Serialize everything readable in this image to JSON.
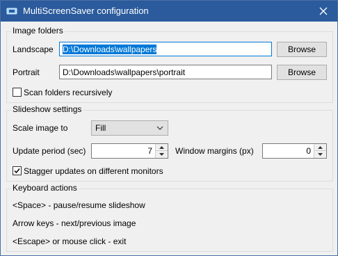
{
  "window": {
    "title": "MultiScreenSaver configuration"
  },
  "image_folders": {
    "title": "Image folders",
    "landscape": {
      "label": "Landscape",
      "value": "D:\\Downloads\\wallpapers",
      "browse": "Browse"
    },
    "portrait": {
      "label": "Portrait",
      "value": "D:\\Downloads\\wallpapers\\portrait",
      "browse": "Browse"
    },
    "recursive": {
      "label": "Scan folders recursively",
      "checked": false
    }
  },
  "slideshow": {
    "title": "Slideshow settings",
    "scale": {
      "label": "Scale image to",
      "value": "Fill"
    },
    "update_period": {
      "label": "Update period (sec)",
      "value": "7"
    },
    "window_margins": {
      "label": "Window margins (px)",
      "value": "0"
    },
    "stagger": {
      "label": "Stagger updates on different monitors",
      "checked": true
    }
  },
  "keyboard": {
    "title": "Keyboard actions",
    "lines": [
      "<Space> - pause/resume slideshow",
      "Arrow keys - next/previous image",
      "<Escape> or mouse click - exit"
    ]
  },
  "colors": {
    "titlebar": "#2b5b9c",
    "accent": "#0078d7"
  }
}
